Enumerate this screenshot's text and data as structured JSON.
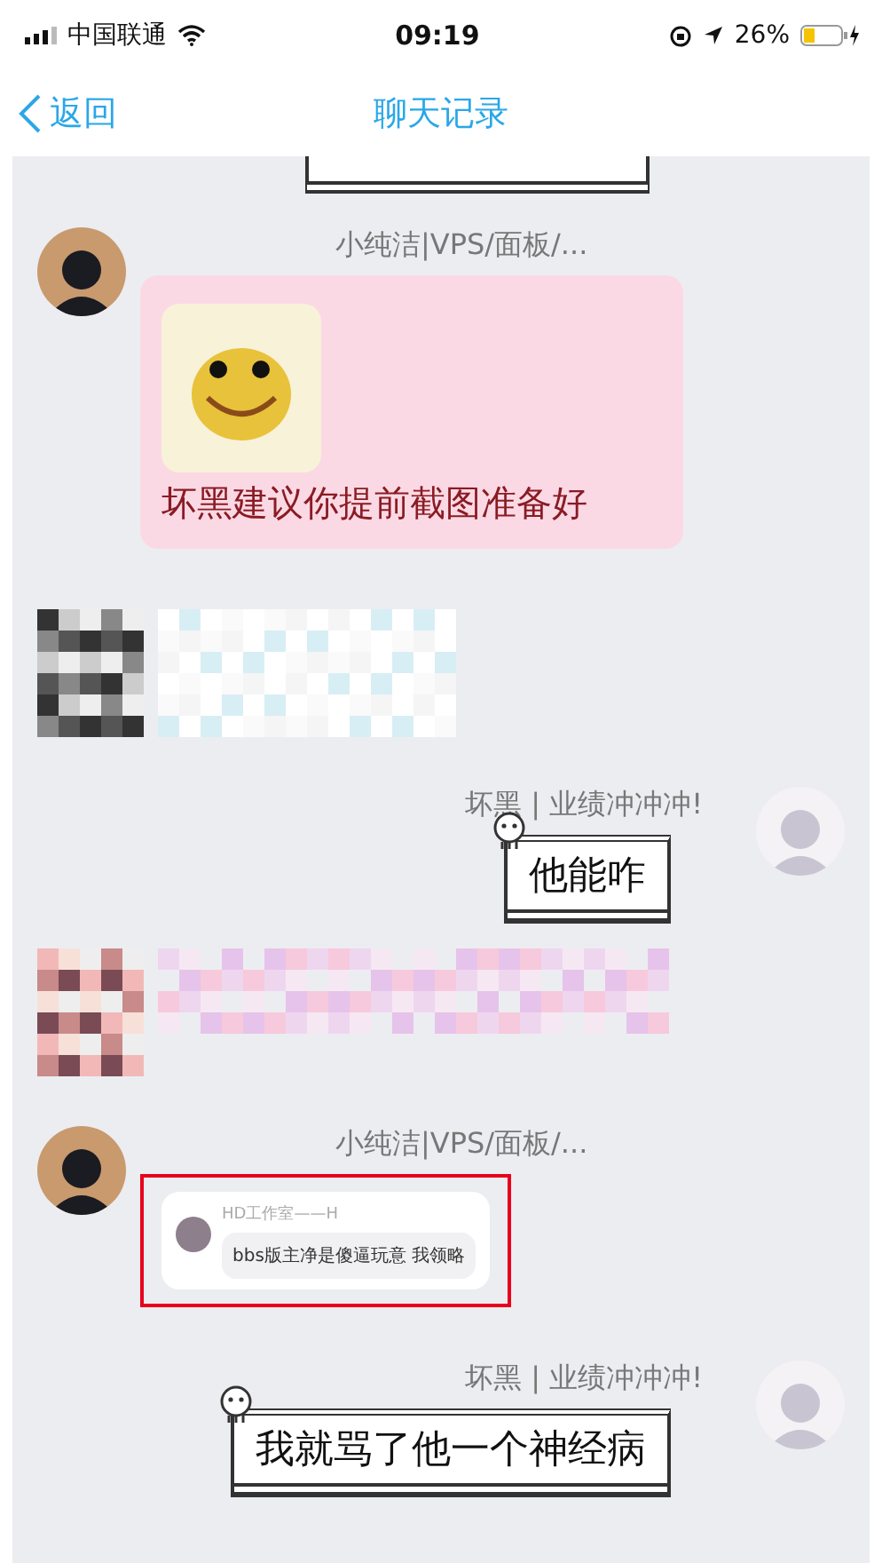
{
  "status_bar": {
    "carrier": "中国联通",
    "time": "09:19",
    "battery": "26%"
  },
  "nav": {
    "back": "返回",
    "title": "聊天记录"
  },
  "messages": [
    {
      "kind": "cutoff",
      "outgoing": true
    },
    {
      "kind": "sticker_text",
      "outgoing": false,
      "sender": "小纯洁|VPS/面板/...",
      "text": "坏黑建议你提前截图准备好"
    },
    {
      "kind": "pixelated",
      "outgoing": false
    },
    {
      "kind": "scroll",
      "outgoing": true,
      "sender": "坏黑 | 业绩冲冲冲!",
      "text": "他能咋"
    },
    {
      "kind": "pixelated",
      "outgoing": false
    },
    {
      "kind": "quote",
      "outgoing": false,
      "sender": "小纯洁|VPS/面板/...",
      "highlighted": true,
      "quote_name": "HD工作室——H",
      "quote_text": "bbs版主净是傻逼玩意 我领略"
    },
    {
      "kind": "scroll",
      "outgoing": true,
      "sender": "坏黑 | 业绩冲冲冲!",
      "text": "我就骂了他一个神经病"
    }
  ]
}
